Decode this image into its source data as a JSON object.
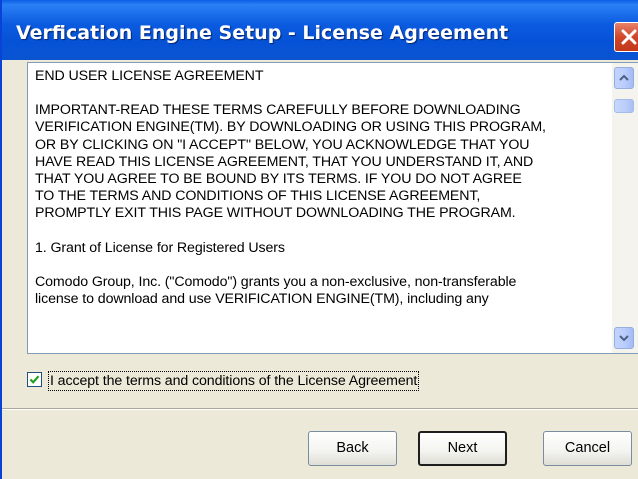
{
  "window": {
    "title": "Verfication Engine Setup - License Agreement"
  },
  "license": {
    "heading": "END USER LICENSE AGREEMENT",
    "important_lines": [
      "IMPORTANT-READ THESE TERMS CAREFULLY BEFORE DOWNLOADING",
      "VERIFICATION ENGINE(TM). BY DOWNLOADING OR USING THIS PROGRAM,",
      "OR BY CLICKING ON \"I ACCEPT\" BELOW, YOU ACKNOWLEDGE THAT YOU",
      "HAVE READ THIS LICENSE AGREEMENT, THAT YOU UNDERSTAND IT, AND",
      "THAT YOU AGREE TO BE BOUND BY ITS TERMS. IF YOU DO NOT AGREE",
      "TO THE TERMS AND CONDITIONS OF THIS LICENSE AGREEMENT,",
      "PROMPTLY EXIT THIS PAGE WITHOUT DOWNLOADING THE PROGRAM."
    ],
    "section_title": "1. Grant of License for Registered Users",
    "section_lines": [
      "Comodo Group, Inc. (\"Comodo\") grants you a non-exclusive, non-transferable",
      "license to download and use VERIFICATION ENGINE(TM), including any"
    ]
  },
  "accept": {
    "label": "I accept the terms and conditions of the License Agreement",
    "checked": true
  },
  "buttons": {
    "back": "Back",
    "next": "Next",
    "cancel": "Cancel"
  },
  "icons": {
    "close": "close-icon",
    "scroll_up": "arrow-up-icon",
    "scroll_down": "arrow-down-icon",
    "checkmark": "checkmark-icon"
  },
  "colors": {
    "titlebar": "#0652D6",
    "window_bg": "#ECE9D8",
    "close_button": "#D2472A"
  }
}
